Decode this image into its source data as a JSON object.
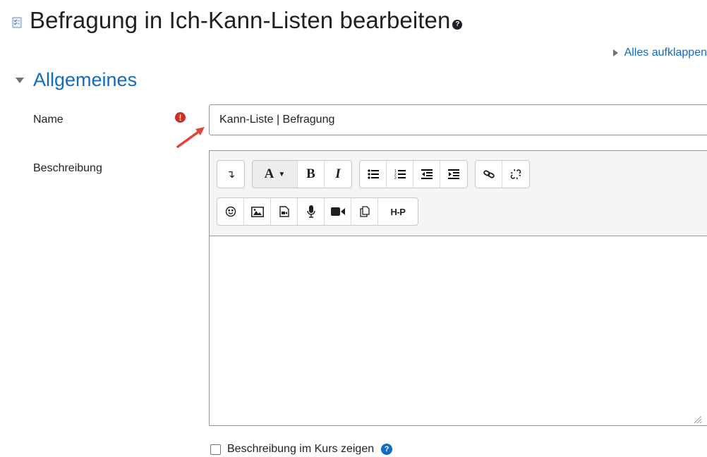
{
  "header": {
    "title": "Befragung in Ich-Kann-Listen bearbeiten",
    "help_glyph": "?"
  },
  "expand_all": {
    "label": "Alles aufklappen"
  },
  "section": {
    "title": "Allgemeines"
  },
  "form": {
    "name_label": "Name",
    "required_glyph": "!",
    "name_value": "Kann-Liste | Befragung",
    "description_label": "Beschreibung",
    "show_description_label": "Beschreibung im Kurs zeigen",
    "show_description_checked": false
  },
  "toolbar": {
    "collapse_glyph": "↴",
    "font_style_label": "A",
    "bold_label": "B",
    "italic_label": "I",
    "h5p_label": "H-P"
  },
  "colors": {
    "link": "#0f6cbf",
    "required": "#ca3120",
    "arrow": "#e0443a"
  }
}
